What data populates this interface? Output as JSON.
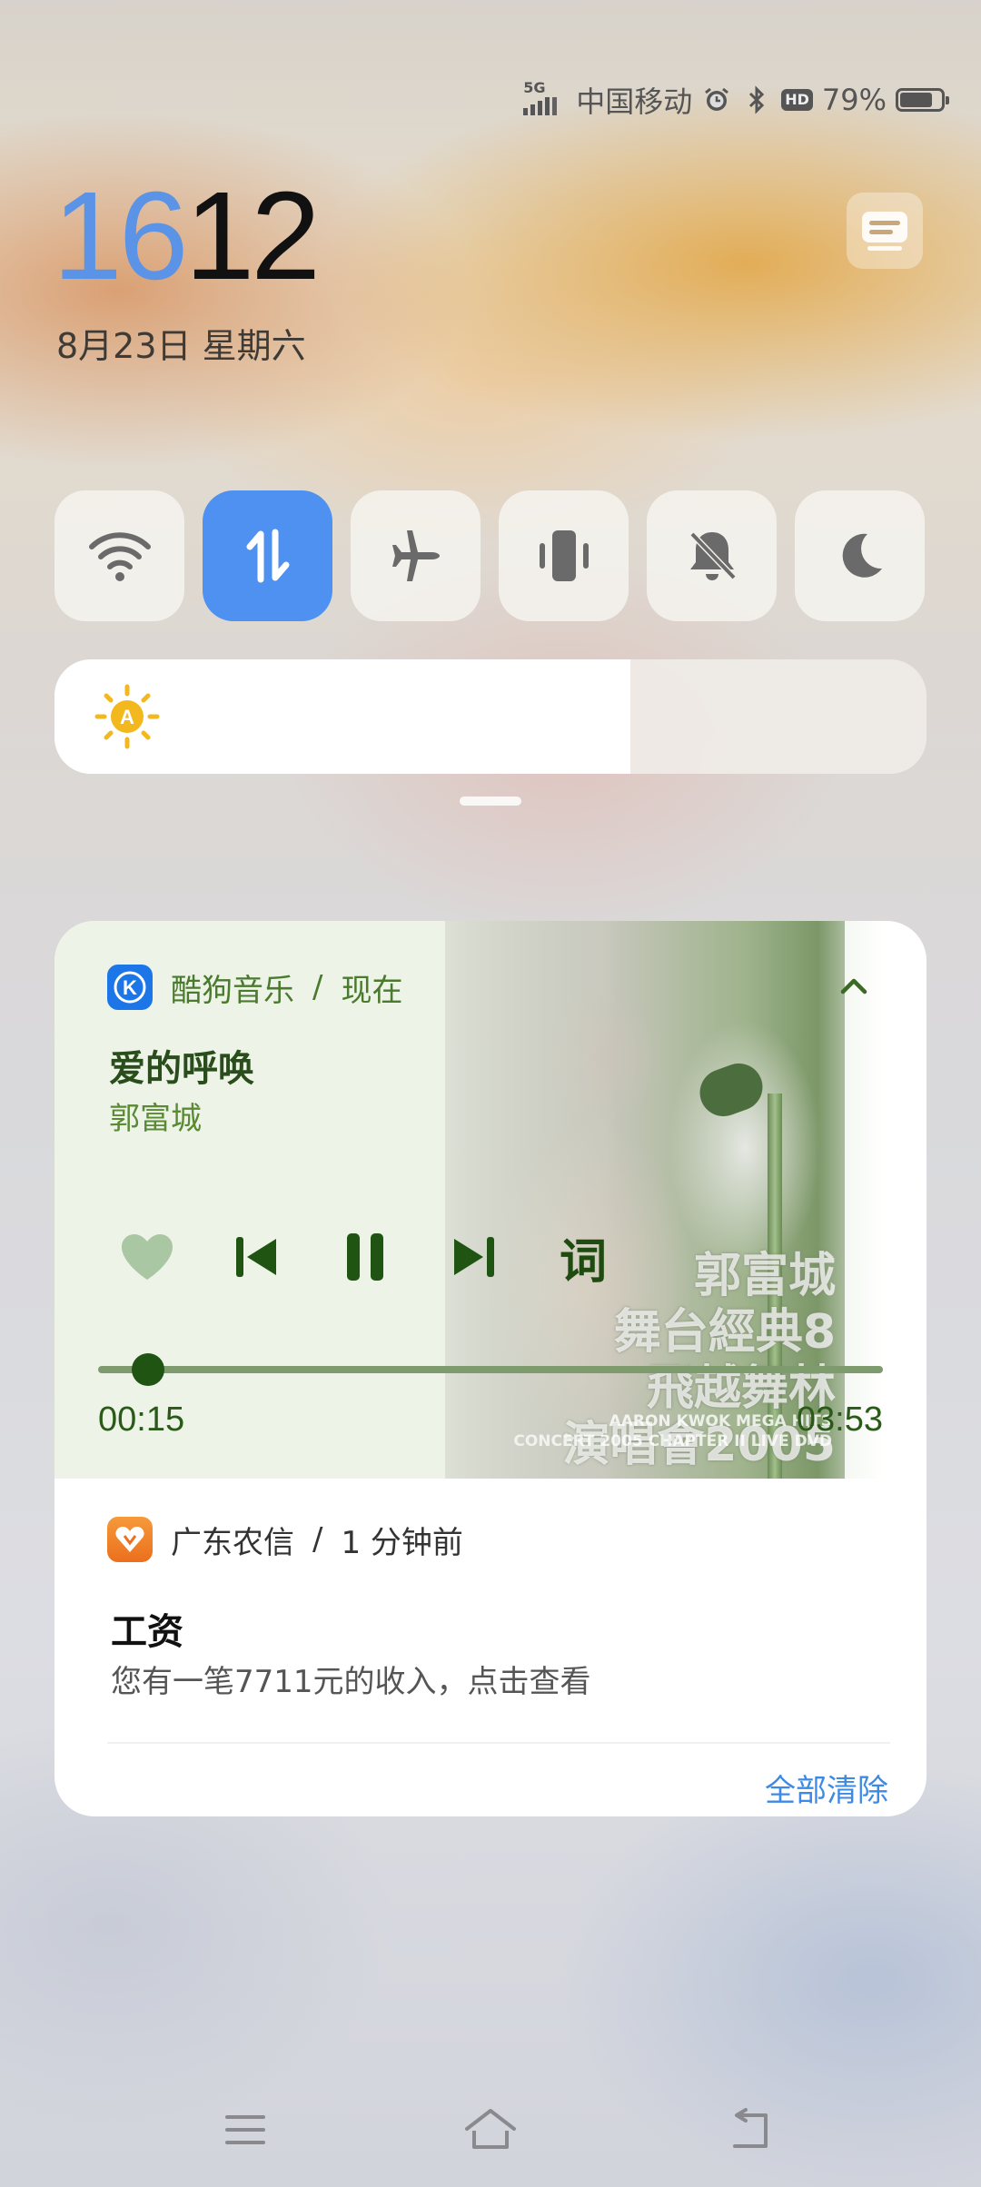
{
  "status_bar": {
    "network": "5G",
    "carrier": "中国移动",
    "icons": [
      "signal-icon",
      "alarm-icon",
      "bluetooth-icon",
      "hd-voice-icon"
    ],
    "hd": "HD",
    "battery_text": "79%",
    "battery_level": 0.79
  },
  "clock": {
    "hour": "16",
    "minute": "12",
    "date": "8月23日 星期六"
  },
  "edit_button_icon": "edit-tiles-icon",
  "quick_toggles": [
    {
      "name": "wifi",
      "icon": "wifi-icon",
      "active": false
    },
    {
      "name": "mobile-data",
      "icon": "mobile-data-icon",
      "active": true
    },
    {
      "name": "airplane-mode",
      "icon": "airplane-icon",
      "active": false
    },
    {
      "name": "vibrate",
      "icon": "vibrate-icon",
      "active": false
    },
    {
      "name": "mute",
      "icon": "bell-off-icon",
      "active": false
    },
    {
      "name": "dark-mode",
      "icon": "moon-icon",
      "active": false
    }
  ],
  "brightness": {
    "level": 0.66,
    "icon": "auto-brightness-icon",
    "auto_label": "A"
  },
  "music": {
    "app_name": "酷狗音乐",
    "separator": "/",
    "time": "现在",
    "app_icon_letter": "K",
    "song": "爱的呼唤",
    "artist": "郭富城",
    "lyrics_label": "词",
    "current_time": "00:15",
    "total_time": "03:53",
    "progress": 0.064,
    "cover_text": "郭富城\n舞台經典8\n飛越舞林\n演唱會2005",
    "cover_subtext": "AARON KWOK MEGA HITS\nCONCERT 2005 CHAPTER II LIVE DVD",
    "accent": "#2a5a18"
  },
  "bank_notification": {
    "app_name": "广东农信",
    "separator": "/",
    "time": "1 分钟前",
    "title": "工资",
    "body": "您有一笔7711元的收入，点击查看",
    "clear_all": "全部清除"
  }
}
